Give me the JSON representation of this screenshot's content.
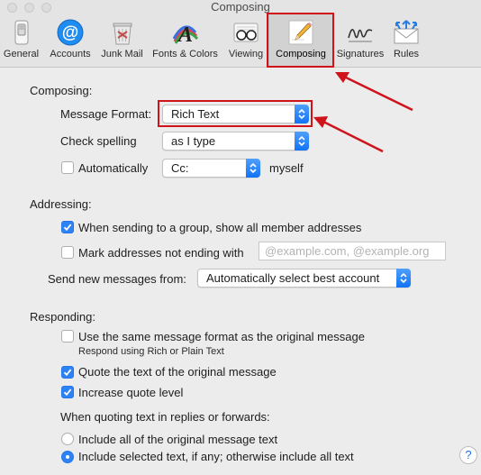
{
  "window": {
    "title": "Composing"
  },
  "toolbar": {
    "items": [
      {
        "label": "General",
        "icon": "switch-icon"
      },
      {
        "label": "Accounts",
        "icon": "at-sign-icon"
      },
      {
        "label": "Junk Mail",
        "icon": "trash-icon"
      },
      {
        "label": "Fonts & Colors",
        "icon": "font-icon"
      },
      {
        "label": "Viewing",
        "icon": "glasses-icon"
      },
      {
        "label": "Composing",
        "icon": "pencil-icon",
        "selected": true
      },
      {
        "label": "Signatures",
        "icon": "signature-icon"
      },
      {
        "label": "Rules",
        "icon": "rules-icon"
      }
    ]
  },
  "composing": {
    "heading": "Composing:",
    "message_format_label": "Message Format:",
    "message_format_value": "Rich Text",
    "check_spelling_label": "Check spelling",
    "check_spelling_value": "as I type",
    "automatically_label": "Automatically",
    "automatically_checked": false,
    "auto_cc_value": "Cc:",
    "myself_label": "myself"
  },
  "addressing": {
    "heading": "Addressing:",
    "group_label": "When sending to a group, show all member addresses",
    "group_checked": true,
    "mark_label": "Mark addresses not ending with",
    "mark_checked": false,
    "mark_placeholder": "@example.com, @example.org",
    "send_from_label": "Send new messages from:",
    "send_from_value": "Automatically select best account"
  },
  "responding": {
    "heading": "Responding:",
    "same_format_label": "Use the same message format as the original message",
    "same_format_checked": false,
    "same_format_sub": "Respond using Rich or Plain Text",
    "quote_label": "Quote the text of the original message",
    "quote_checked": true,
    "increase_label": "Increase quote level",
    "increase_checked": true,
    "quoting_heading": "When quoting text in replies or forwards:",
    "include_all_label": "Include all of the original message text",
    "include_selected_label": "Include selected text, if any; otherwise include all text",
    "selected_option": "include_selected"
  },
  "help": {
    "label": "?"
  },
  "colors": {
    "accent": "#2d83f6",
    "annotation": "#d0121b"
  }
}
